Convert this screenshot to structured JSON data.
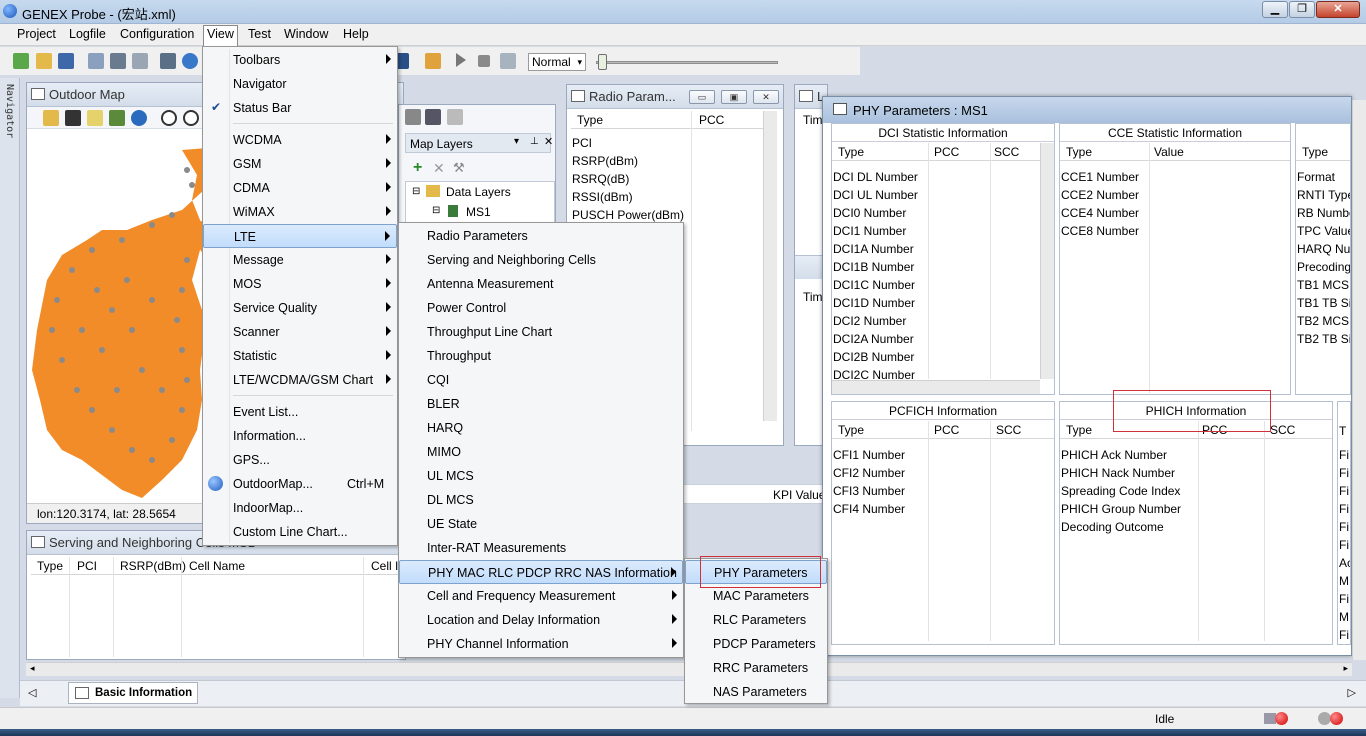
{
  "window": {
    "title": "GENEX Probe - (宏站.xml)"
  },
  "menubar": [
    "Project",
    "Logfile",
    "Configuration",
    "View",
    "Test",
    "Window",
    "Help"
  ],
  "toolbar": {
    "mode_select": "Normal"
  },
  "navigator_strip": "Navigator",
  "outdoor_map": {
    "title": "Outdoor Map",
    "coords": "lon:120.3174, lat: 28.5654"
  },
  "map_layers": {
    "title": "Map Layers",
    "tree": [
      "Data Layers",
      "MS1"
    ]
  },
  "radio_params": {
    "title": "Radio Param...",
    "columns": [
      "Type",
      "PCC"
    ],
    "rows": [
      "PCI",
      "RSRP(dBm)",
      "RSRQ(dB)",
      "RSSI(dBm)",
      "PUSCH Power(dBm)"
    ]
  },
  "mid_panel": {
    "col1": "Tim",
    "col2": "Tim",
    "title": "L",
    "kpi": "KPI Value"
  },
  "serving_cells": {
    "title": "Serving and Neighboring Cells MS1",
    "columns": [
      "Type",
      "PCI",
      "RSRP(dBm)",
      "Cell Name",
      "Cell I"
    ]
  },
  "bottom_tab": "Basic Information",
  "status": {
    "text": "Idle"
  },
  "view_menu": {
    "items": [
      {
        "label": "Toolbars",
        "sub": true
      },
      {
        "label": "Navigator",
        "sub": false
      },
      {
        "label": "Status Bar",
        "sub": false,
        "checked": true
      },
      {
        "label": "WCDMA",
        "sub": true
      },
      {
        "label": "GSM",
        "sub": true
      },
      {
        "label": "CDMA",
        "sub": true
      },
      {
        "label": "WiMAX",
        "sub": true
      },
      {
        "label": "LTE",
        "sub": true,
        "highlight": true
      },
      {
        "label": "Message",
        "sub": true
      },
      {
        "label": "MOS",
        "sub": true
      },
      {
        "label": "Service Quality",
        "sub": true
      },
      {
        "label": "Scanner",
        "sub": true
      },
      {
        "label": "Statistic",
        "sub": true
      },
      {
        "label": "LTE/WCDMA/GSM Chart",
        "sub": true
      },
      {
        "label": "Event List...",
        "sub": false
      },
      {
        "label": "Information...",
        "sub": false
      },
      {
        "label": "GPS...",
        "sub": false
      },
      {
        "label": "OutdoorMap...",
        "sub": false,
        "shortcut": "Ctrl+M"
      },
      {
        "label": "IndoorMap...",
        "sub": false
      },
      {
        "label": "Custom Line Chart...",
        "sub": false
      }
    ]
  },
  "lte_menu": {
    "items": [
      {
        "label": "Radio Parameters",
        "sub": false
      },
      {
        "label": "Serving and Neighboring Cells",
        "sub": false
      },
      {
        "label": "Antenna Measurement",
        "sub": false
      },
      {
        "label": "Power Control",
        "sub": false
      },
      {
        "label": "Throughput Line Chart",
        "sub": false
      },
      {
        "label": "Throughput",
        "sub": false
      },
      {
        "label": "CQI",
        "sub": false
      },
      {
        "label": "BLER",
        "sub": false
      },
      {
        "label": "HARQ",
        "sub": false
      },
      {
        "label": "MIMO",
        "sub": false
      },
      {
        "label": "UL MCS",
        "sub": false
      },
      {
        "label": "DL MCS",
        "sub": false
      },
      {
        "label": "UE State",
        "sub": false
      },
      {
        "label": "Inter-RAT Measurements",
        "sub": false
      },
      {
        "label": "PHY MAC RLC PDCP RRC NAS Information",
        "sub": true,
        "highlight": true
      },
      {
        "label": "Cell and Frequency Measurement",
        "sub": true
      },
      {
        "label": "Location and Delay Information",
        "sub": true
      },
      {
        "label": "PHY Channel Information",
        "sub": true
      }
    ]
  },
  "phy_menu": {
    "items": [
      {
        "label": "PHY Parameters",
        "highlight": true
      },
      {
        "label": "MAC Parameters"
      },
      {
        "label": "RLC Parameters"
      },
      {
        "label": "PDCP Parameters"
      },
      {
        "label": "RRC Parameters"
      },
      {
        "label": "NAS Parameters"
      }
    ]
  },
  "phy_window": {
    "title": "PHY Parameters : MS1",
    "dci": {
      "title": "DCI Statistic Information",
      "columns": [
        "Type",
        "PCC",
        "SCC"
      ],
      "rows": [
        "DCI DL Number",
        "DCI UL Number",
        "DCI0 Number",
        "DCI1 Number",
        "DCI1A Number",
        "DCI1B Number",
        "DCI1C Number",
        "DCI1D Number",
        "DCI2 Number",
        "DCI2A Number",
        "DCI2B Number",
        "DCI2C Number"
      ]
    },
    "cce": {
      "title": "CCE Statistic Information",
      "columns": [
        "Type",
        "Value"
      ],
      "rows": [
        "CCE1 Number",
        "CCE2 Number",
        "CCE4 Number",
        "CCE8 Number"
      ]
    },
    "right_partial": {
      "columns": [
        "Type"
      ],
      "rows": [
        "Format",
        "RNTI Type",
        "RB Numbe",
        "TPC Value",
        "HARQ Nun",
        "Precoding",
        "TB1 MCS",
        "TB1 TB Siz",
        "TB2 MCS",
        "TB2 TB Siz"
      ]
    },
    "pcfich": {
      "title": "PCFICH Information",
      "columns": [
        "Type",
        "PCC",
        "SCC"
      ],
      "rows": [
        "CFI1 Number",
        "CFI2 Number",
        "CFI3 Number",
        "CFI4 Number"
      ]
    },
    "phich": {
      "title": "PHICH Information",
      "columns": [
        "Type",
        "PCC",
        "SCC"
      ],
      "rows": [
        "PHICH Ack Number",
        "PHICH Nack Number",
        "Spreading Code Index",
        "PHICH Group Number",
        "Decoding Outcome"
      ]
    },
    "right_partial2": {
      "columns": [
        "T"
      ],
      "rows": [
        "Fi",
        "Fi",
        "Fi",
        "Fi",
        "Fi",
        "Fi",
        "Ac",
        "M",
        "Fi",
        "M",
        "Fi"
      ]
    }
  },
  "colors": {
    "highlight_box": "#d0303a",
    "map_fill": "#f28c28",
    "map_dots": "#8a8a8a"
  }
}
